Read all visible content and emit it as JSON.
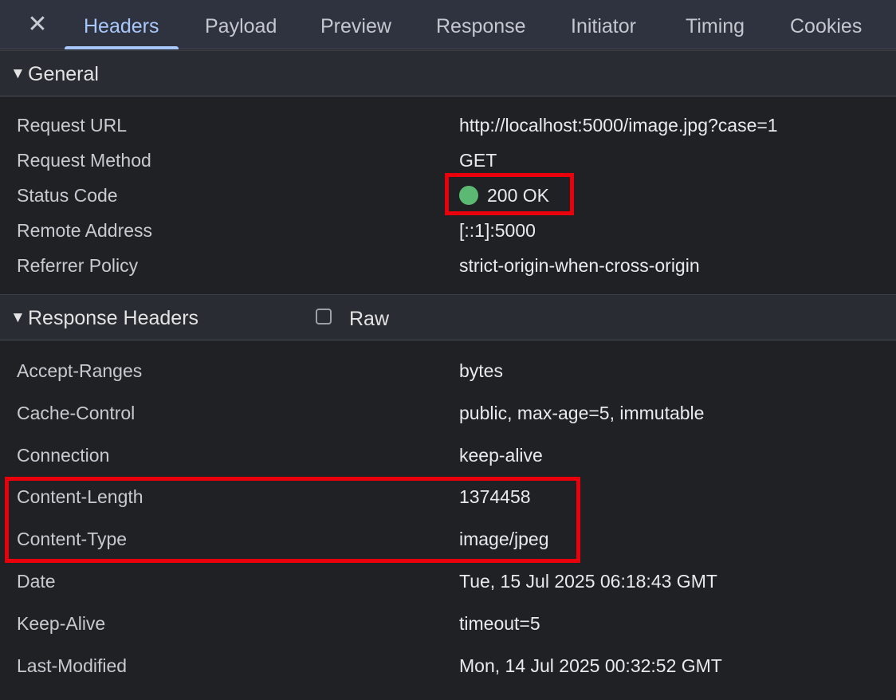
{
  "tabs": {
    "close_icon": "close-icon",
    "items": [
      "Headers",
      "Payload",
      "Preview",
      "Response",
      "Initiator",
      "Timing",
      "Cookies"
    ],
    "active": "Headers"
  },
  "general": {
    "title": "General",
    "rows": [
      {
        "name": "Request URL",
        "value": "http://localhost:5000/image.jpg?case=1"
      },
      {
        "name": "Request Method",
        "value": "GET"
      },
      {
        "name": "Status Code",
        "value": "200 OK"
      },
      {
        "name": "Remote Address",
        "value": "[::1]:5000"
      },
      {
        "name": "Referrer Policy",
        "value": "strict-origin-when-cross-origin"
      }
    ]
  },
  "response_headers": {
    "title": "Response Headers",
    "raw_label": "Raw",
    "rows": [
      {
        "name": "Accept-Ranges",
        "value": "bytes"
      },
      {
        "name": "Cache-Control",
        "value": "public, max-age=5, immutable"
      },
      {
        "name": "Connection",
        "value": "keep-alive"
      },
      {
        "name": "Content-Length",
        "value": "1374458"
      },
      {
        "name": "Content-Type",
        "value": "image/jpeg"
      },
      {
        "name": "Date",
        "value": "Tue, 15 Jul 2025 06:18:43 GMT"
      },
      {
        "name": "Keep-Alive",
        "value": "timeout=5"
      },
      {
        "name": "Last-Modified",
        "value": "Mon, 14 Jul 2025 00:32:52 GMT"
      }
    ]
  },
  "colors": {
    "status_ok": "#5bb974",
    "highlight": "#e8000b",
    "accent": "#a8c7fa"
  }
}
